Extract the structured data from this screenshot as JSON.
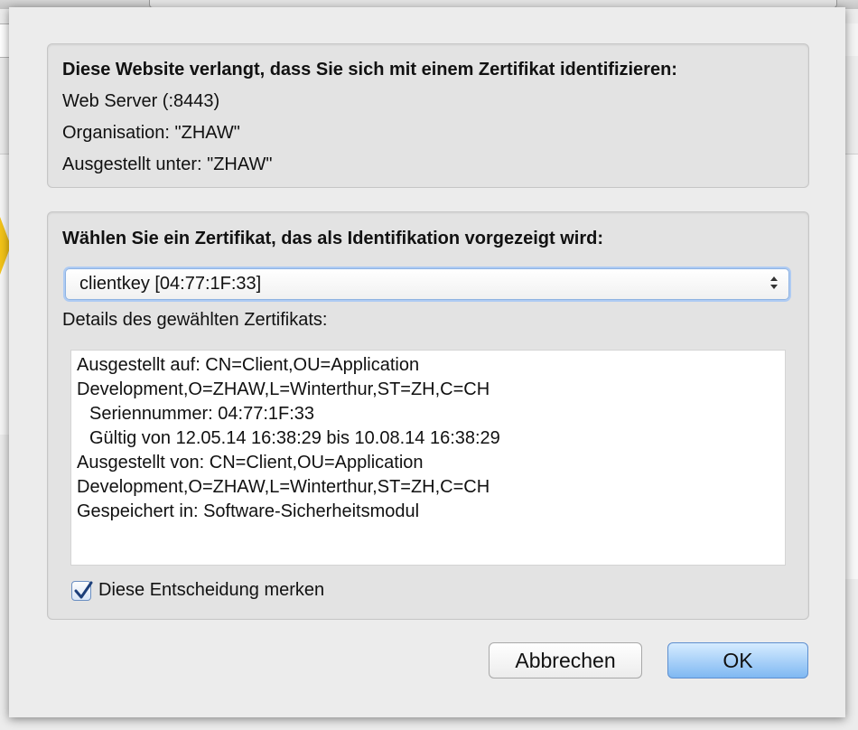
{
  "identity_box": {
    "heading": "Diese Website verlangt, dass Sie sich mit einem Zertifikat identifizieren:",
    "server": "Web Server (:8443)",
    "organisation": "Organisation: \"ZHAW\"",
    "issued_under": "Ausgestellt unter: \"ZHAW\""
  },
  "selection_box": {
    "heading": "Wählen Sie ein Zertifikat, das als Identifikation vorgezeigt wird:",
    "selected_certificate": "clientkey [04:77:1F:33]",
    "details_label": "Details des gewählten Zertifikats:",
    "details": {
      "issued_to_1": "Ausgestellt auf: CN=Client,OU=Application",
      "issued_to_2": "Development,O=ZHAW,L=Winterthur,ST=ZH,C=CH",
      "serial": "Seriennummer: 04:77:1F:33",
      "validity": "Gültig von 12.05.14 16:38:29 bis 10.08.14 16:38:29",
      "issued_by_1": "Ausgestellt von: CN=Client,OU=Application",
      "issued_by_2": "Development,O=ZHAW,L=Winterthur,ST=ZH,C=CH",
      "stored_in": "Gespeichert in: Software-Sicherheitsmodul"
    },
    "remember_label": "Diese Entscheidung merken",
    "remember_checked": true
  },
  "buttons": {
    "cancel": "Abbrechen",
    "ok": "OK"
  },
  "colors": {
    "ok_button": "#7fb8f2",
    "focus_ring": "#aecbf3",
    "warning": "#f3c318"
  }
}
